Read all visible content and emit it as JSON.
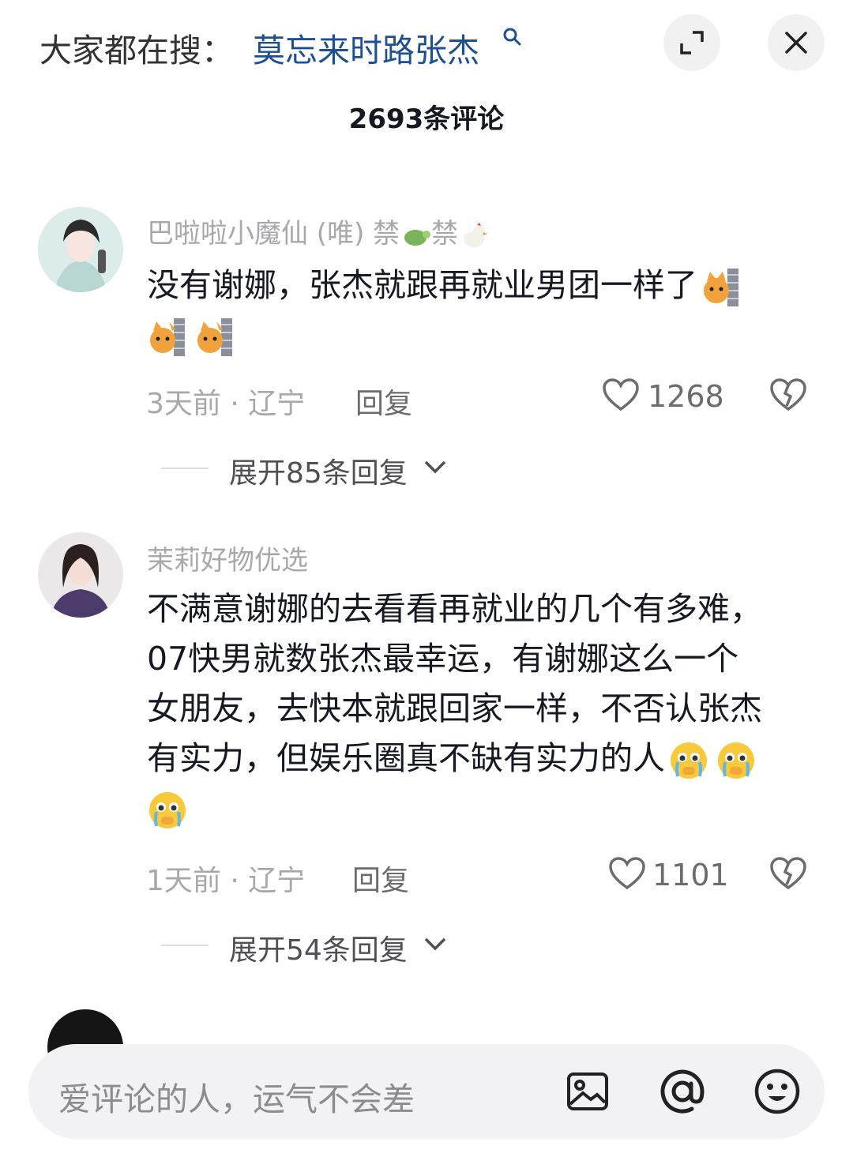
{
  "header": {
    "search_prefix": "大家都在搜：",
    "search_term": "莫忘来时路张杰",
    "comment_count": "2693条评论"
  },
  "comments": [
    {
      "username": "巴啦啦小魔仙 (唯) 禁",
      "username_suffix": "禁",
      "text_main": "没有谢娜，张杰就跟再就业男团一样了",
      "time": "3天前",
      "location": "辽宁",
      "reply_label": "回复",
      "likes": "1268",
      "expand_label": "展开85条回复"
    },
    {
      "username": "茉莉好物优选",
      "text_lines": [
        "不满意谢娜的去看看再就业的几个有多难，",
        "07快男就数张杰最幸运，有谢娜这么一个",
        "女朋友，去快本就跟回家一样，不否认张杰",
        "有实力，但娱乐圈真不缺有实力的人"
      ],
      "time": "1天前",
      "location": "辽宁",
      "reply_label": "回复",
      "likes": "1101",
      "expand_label": "展开54条回复"
    }
  ],
  "input_bar": {
    "placeholder": "爱评论的人，运气不会差"
  },
  "colors": {
    "search_term": "#1e4f8f",
    "username": "#a8a8ac",
    "text": "#161823",
    "input_bg": "#f2f2f4"
  }
}
